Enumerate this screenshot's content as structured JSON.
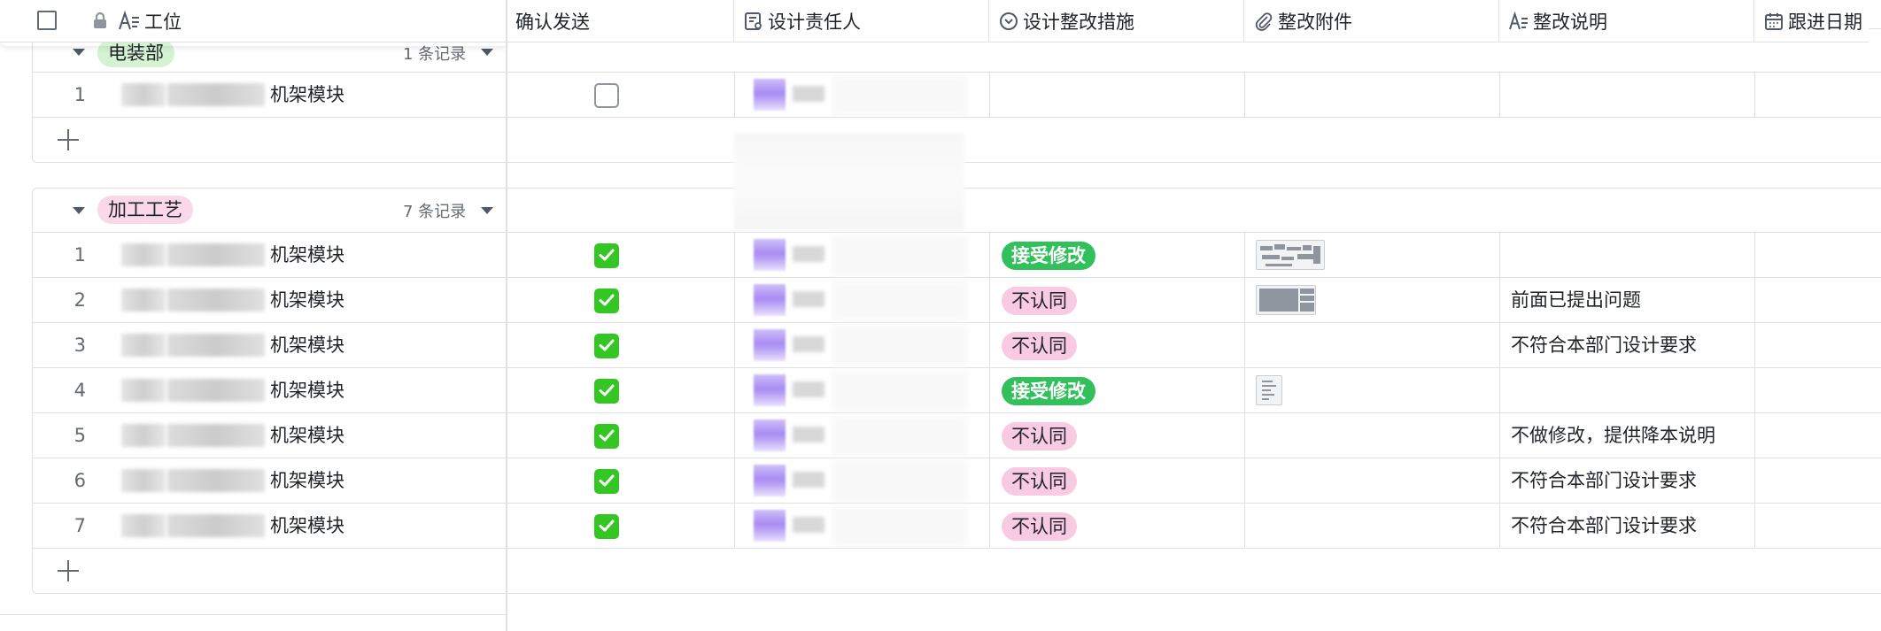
{
  "header": {
    "primary_field": "工位",
    "columns": [
      {
        "key": "confirm",
        "label": "确认发送",
        "icon": "none"
      },
      {
        "key": "designer",
        "label": "设计责任人",
        "icon": "person-field-icon"
      },
      {
        "key": "measure",
        "label": "设计整改措施",
        "icon": "single-select-icon"
      },
      {
        "key": "attachment",
        "label": "整改附件",
        "icon": "attachment-icon"
      },
      {
        "key": "note",
        "label": "整改说明",
        "icon": "text-field-icon"
      },
      {
        "key": "followup",
        "label": "跟进日期",
        "icon": "date-field-icon"
      }
    ]
  },
  "groups": [
    {
      "name": "电装部",
      "count_label": "1 条记录",
      "color": "#d5f2d3",
      "rows": [
        {
          "index": "1",
          "name": "机架模块",
          "confirmed": false,
          "measure": "",
          "measure_type": "",
          "attachment": "",
          "note": ""
        }
      ]
    },
    {
      "name": "加工工艺",
      "count_label": "7 条记录",
      "color": "#fbd7ea",
      "rows": [
        {
          "index": "1",
          "name": "机架模块",
          "confirmed": true,
          "measure": "接受修改",
          "measure_type": "accept",
          "attachment": "thumb-wide",
          "note": ""
        },
        {
          "index": "2",
          "name": "机架模块",
          "confirmed": true,
          "measure": "不认同",
          "measure_type": "disagree",
          "attachment": "thumb-screen",
          "note": "前面已提出问题"
        },
        {
          "index": "3",
          "name": "机架模块",
          "confirmed": true,
          "measure": "不认同",
          "measure_type": "disagree",
          "attachment": "",
          "note": "不符合本部门设计要求"
        },
        {
          "index": "4",
          "name": "机架模块",
          "confirmed": true,
          "measure": "接受修改",
          "measure_type": "accept",
          "attachment": "thumb-doc",
          "note": ""
        },
        {
          "index": "5",
          "name": "机架模块",
          "confirmed": true,
          "measure": "不认同",
          "measure_type": "disagree",
          "attachment": "",
          "note": "不做修改，提供降本说明"
        },
        {
          "index": "6",
          "name": "机架模块",
          "confirmed": true,
          "measure": "不认同",
          "measure_type": "disagree",
          "attachment": "",
          "note": "不符合本部门设计要求"
        },
        {
          "index": "7",
          "name": "机架模块",
          "confirmed": true,
          "measure": "不认同",
          "measure_type": "disagree",
          "attachment": "",
          "note": "不符合本部门设计要求"
        }
      ]
    }
  ],
  "colors": {
    "accept": "#31c05c",
    "disagree": "#f9cbe3",
    "checkbox_on": "#34c724",
    "border": "#dee0e3"
  }
}
